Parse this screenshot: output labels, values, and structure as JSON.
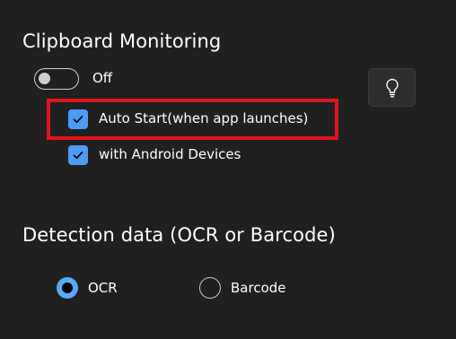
{
  "clipboard": {
    "heading": "Clipboard Monitoring",
    "toggle_state": "Off",
    "toggle_on": false,
    "auto_start_label": "Auto Start(when app launches)",
    "auto_start_checked": true,
    "android_label": "with Android Devices",
    "android_checked": true,
    "tip_button_icon": "lightbulb-icon"
  },
  "detection": {
    "heading": "Detection data (OCR or Barcode)",
    "options": [
      {
        "label": "OCR",
        "selected": true
      },
      {
        "label": "Barcode",
        "selected": false
      }
    ]
  },
  "colors": {
    "background": "#202020",
    "accent": "#4c9cf5",
    "highlight_border": "#e0141c"
  }
}
